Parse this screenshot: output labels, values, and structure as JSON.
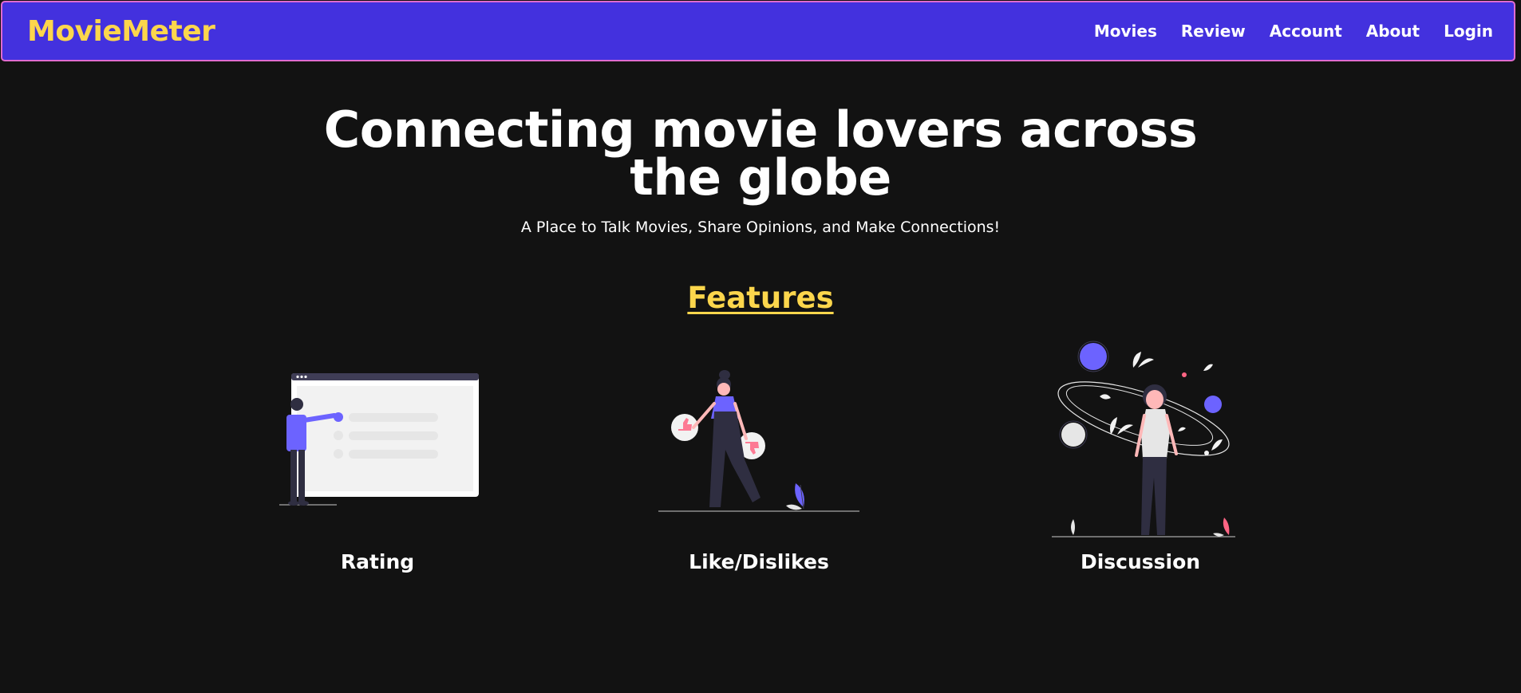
{
  "brand": "MovieMeter",
  "nav": {
    "items": [
      {
        "label": "Movies"
      },
      {
        "label": "Review"
      },
      {
        "label": "Account"
      },
      {
        "label": "About"
      },
      {
        "label": "Login"
      }
    ]
  },
  "hero": {
    "title": "Connecting movie lovers across the globe",
    "subtitle": "A Place to Talk Movies, Share Opinions, and Make Connections!"
  },
  "features": {
    "heading": "Features",
    "items": [
      {
        "label": "Rating",
        "icon": "rating-illustration"
      },
      {
        "label": "Like/Dislikes",
        "icon": "like-dislike-illustration"
      },
      {
        "label": "Discussion",
        "icon": "discussion-illustration"
      }
    ]
  },
  "colors": {
    "background": "#121212",
    "navbar": "#4331de",
    "navbar_border": "#e06bcf",
    "brand": "#fcd64c",
    "accent": "#6c63ff"
  }
}
